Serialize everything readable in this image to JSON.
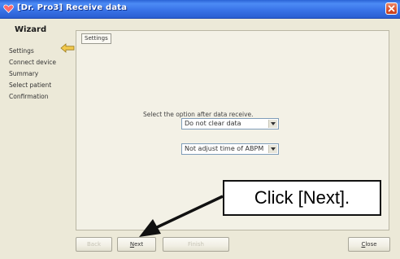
{
  "window": {
    "title": "[Dr. Pro3] Receive data",
    "close_icon": "close-icon"
  },
  "sidebar": {
    "title": "Wizard",
    "current_step_indicator": "arrow-left-icon",
    "steps": [
      {
        "label": "Settings",
        "current": true
      },
      {
        "label": "Connect device",
        "current": false
      },
      {
        "label": "Summary",
        "current": false
      },
      {
        "label": "Select patient",
        "current": false
      },
      {
        "label": "Confirmation",
        "current": false
      }
    ]
  },
  "main": {
    "tab_label": "Settings",
    "prompt": "Select the option after data receive.",
    "clear_option": {
      "value": "Do not clear data"
    },
    "time_option": {
      "value": "Not adjust time of ABPM"
    }
  },
  "footer": {
    "back_label": "Back",
    "next_label": "Next",
    "next_mnemonic": "N",
    "next_rest": "ext",
    "finish_label": "Finish",
    "close_label": "Close",
    "close_mnemonic": "C",
    "close_rest": "lose"
  },
  "annotation": {
    "callout_text": "Click [Next]."
  },
  "colors": {
    "titlebar": "#2a5ed1",
    "window_bg": "#ece9d8",
    "indicator_arrow": "#f2c94c",
    "close_button": "#d9502d"
  }
}
